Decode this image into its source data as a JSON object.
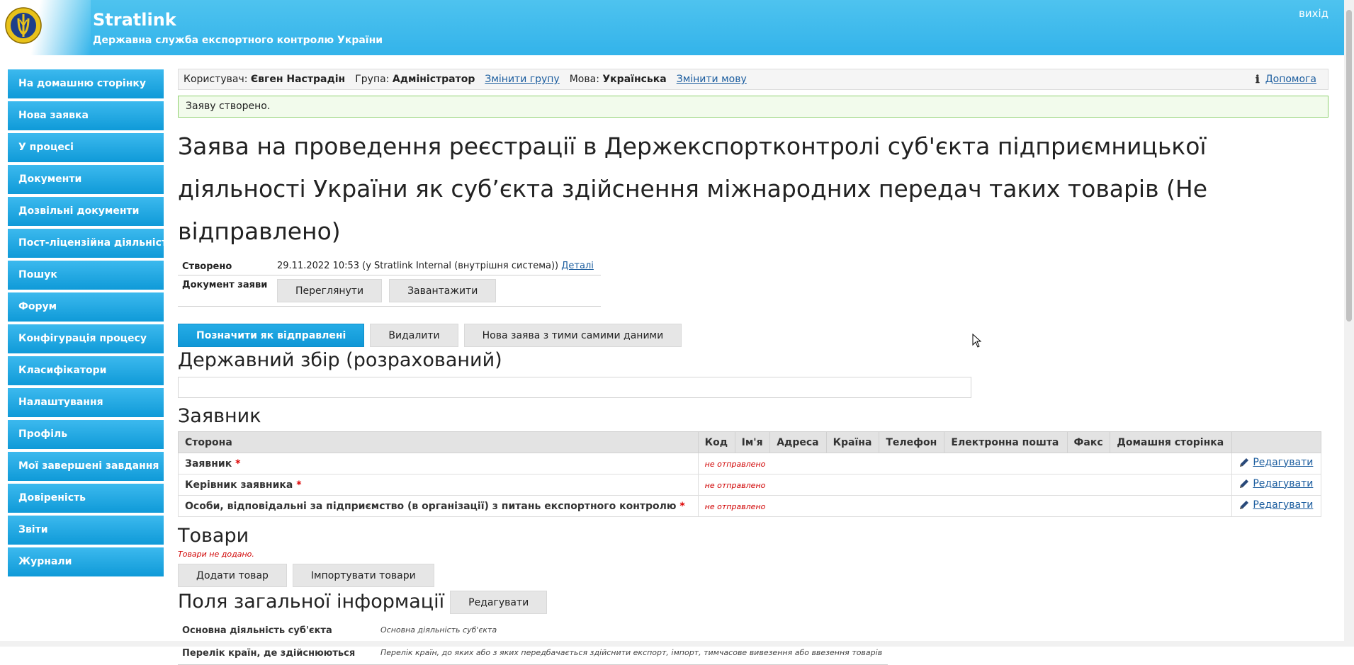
{
  "header": {
    "title": "Stratlink",
    "subtitle": "Державна служба експортного контролю України",
    "exit": "вихід"
  },
  "sidebar": {
    "items": [
      {
        "label": "На домашню сторінку"
      },
      {
        "label": "Нова заявка"
      },
      {
        "label": "У процесі"
      },
      {
        "label": "Документи"
      },
      {
        "label": "Дозвільні документи"
      },
      {
        "label": "Пост-ліцензійна діяльність"
      },
      {
        "label": "Пошук"
      },
      {
        "label": "Форум"
      },
      {
        "label": "Конфігурація процесу"
      },
      {
        "label": "Класифікатори"
      },
      {
        "label": "Налаштування"
      },
      {
        "label": "Профіль"
      },
      {
        "label": "Мої завершені завдання"
      },
      {
        "label": "Довіреність"
      },
      {
        "label": "Звіти"
      },
      {
        "label": "Журнали"
      }
    ]
  },
  "userbar": {
    "user_label": "Користувач:",
    "user_name": "Євген Настрадін",
    "group_label": "Група:",
    "group_name": "Адміністратор",
    "change_group": "Змінити групу",
    "lang_label": "Мова:",
    "lang_name": "Українська",
    "change_lang": "Змінити мову",
    "help": "Допомога"
  },
  "notice": "Заяву створено.",
  "page_title": "Заява на проведення реєстрації в Держекспортконтролі суб'єкта підприємницької діяльності України як суб’єкта здійснення міжнародних передач таких товарів (Не відправлено)",
  "meta": {
    "created_label": "Створено",
    "created_value": "29.11.2022 10:53 (у Stratlink Internal (внутрішня система))",
    "details": "Деталі",
    "doc_label": "Документ заяви",
    "view_btn": "Переглянути",
    "download_btn": "Завантажити"
  },
  "actions": {
    "mark_sent": "Позначити як відправлені",
    "delete": "Видалити",
    "new_same": "Нова заява з тими самими даними"
  },
  "fee": {
    "title": "Державний збір (розрахований)"
  },
  "applicant": {
    "title": "Заявник",
    "columns": [
      "Сторона",
      "Код",
      "Ім'я",
      "Адреса",
      "Країна",
      "Телефон",
      "Електронна пошта",
      "Факс",
      "Домашня сторінка"
    ],
    "rows": [
      {
        "name": "Заявник",
        "status": "не отправлено",
        "edit": "Редагувати"
      },
      {
        "name": "Керівник заявника",
        "status": "не отправлено",
        "edit": "Редагувати"
      },
      {
        "name": "Особи, відповідальні за підприємство (в організації) з питань експортного контролю",
        "status": "не отправлено",
        "edit": "Редагувати"
      }
    ],
    "required_mark": "*"
  },
  "goods": {
    "title": "Товари",
    "empty": "Товари не додано.",
    "add_btn": "Додати товар",
    "import_btn": "Імпортувати товари"
  },
  "general_info": {
    "title": "Поля загальної інформації",
    "edit_btn": "Редагувати",
    "rows": [
      {
        "label": "Основна діяльність суб'єкта",
        "value": "Основна діяльність суб'єкта"
      },
      {
        "label": "Перелік країн, де здійснюються",
        "value": "Перелік країн, до яких або з яких передбачається здійснити експорт, імпорт, тимчасове вивезення або ввезення товарів"
      }
    ]
  },
  "colors": {
    "header": "#33b3ea",
    "sidebar": "#0f9ad8",
    "primary_btn": "#1aa2df",
    "error": "#d00000",
    "notice_border": "#8fd16f"
  }
}
